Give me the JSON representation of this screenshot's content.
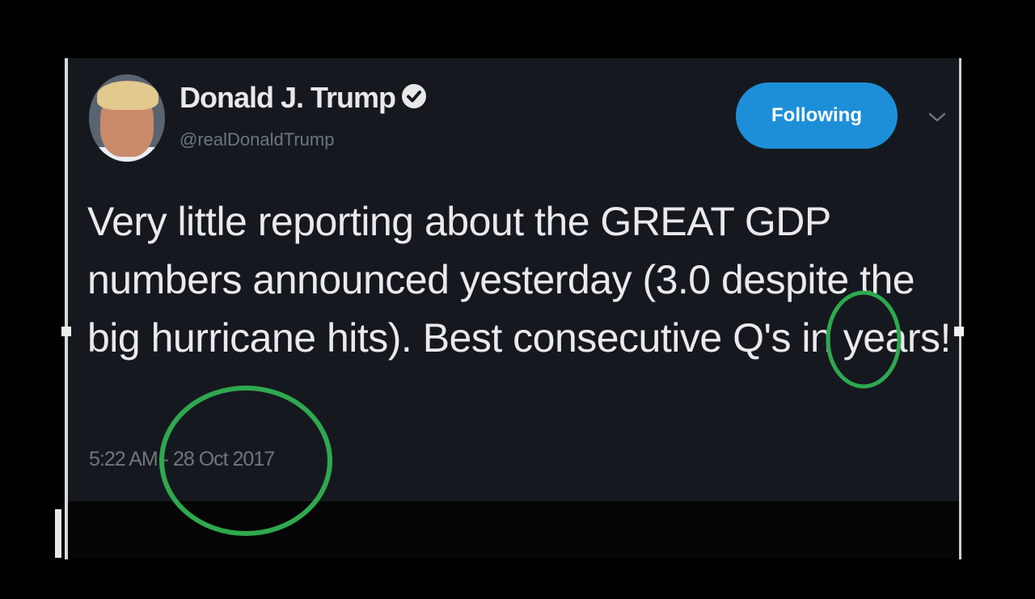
{
  "tweet": {
    "author": {
      "display_name": "Donald J. Trump",
      "handle": "@realDonaldTrump",
      "verified_icon": "verified-badge-icon",
      "avatar": "profile-photo"
    },
    "follow_button_label": "Following",
    "menu_icon": "chevron-down-icon",
    "text": "Very little reporting about the GREAT GDP numbers announced yesterday (3.0 despite the big hurricane hits). Best consecutive Q's in years!",
    "timestamp": "5:22 AM - 28 Oct 2017"
  },
  "colors": {
    "background": "#000000",
    "card": "#15191f",
    "text": "#e8eaec",
    "muted": "#6e767d",
    "accent": "#1d8fd8",
    "annotation": "#2fa84f"
  }
}
